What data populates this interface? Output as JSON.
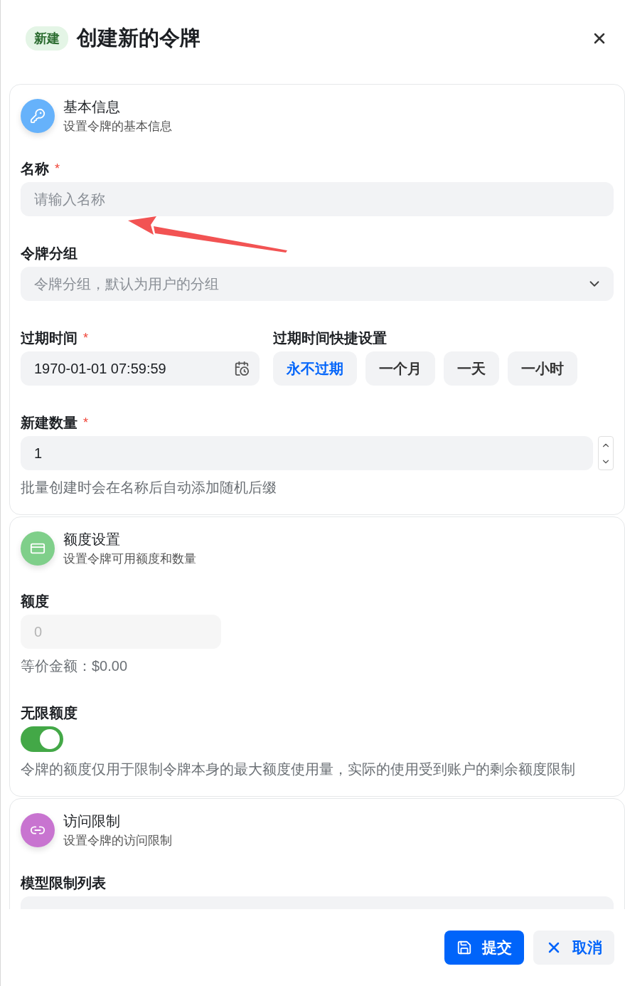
{
  "header": {
    "badge": "新建",
    "title": "创建新的令牌"
  },
  "sections": [
    {
      "kind": "basic",
      "color": "#66b2fb",
      "title": "基本信息",
      "subtitle": "设置令牌的基本信息",
      "fields": [
        {
          "kind": "text",
          "label": "名称",
          "required_mark": "*",
          "placeholder": "请输入名称"
        },
        {
          "kind": "select",
          "label": "令牌分组",
          "placeholder": "令牌分组，默认为用户的分组"
        },
        {
          "kind": "expiry",
          "label": "过期时间",
          "required_mark": "*",
          "value": "1970-01-01 07:59:59",
          "shortcuts_label": "过期时间快捷设置",
          "shortcuts": [
            {
              "label": "永不过期",
              "selected": true
            },
            {
              "label": "一个月",
              "selected": false
            },
            {
              "label": "一天",
              "selected": false
            },
            {
              "label": "一小时",
              "selected": false
            }
          ]
        },
        {
          "kind": "number",
          "label": "新建数量",
          "required_mark": "*",
          "value": "1",
          "help": "批量创建时会在名称后自动添加随机后缀"
        }
      ]
    },
    {
      "kind": "quota",
      "color": "#7fcf8a",
      "title": "额度设置",
      "subtitle": "设置令牌可用额度和数量",
      "fields": [
        {
          "kind": "amount",
          "label": "额度",
          "placeholder": "0",
          "disabled": true,
          "help": "等价金额：$0.00"
        },
        {
          "kind": "toggle",
          "label": "无限额度",
          "on": true,
          "help": "令牌的额度仅用于限制令牌本身的最大额度使用量，实际的使用受到账户的剩余额度限制"
        }
      ]
    },
    {
      "kind": "access",
      "color": "#c874d0",
      "title": "访问限制",
      "subtitle": "设置令牌的访问限制",
      "fields": [
        {
          "kind": "multiselect",
          "label": "模型限制列表"
        }
      ]
    }
  ],
  "footer": {
    "buttons": [
      {
        "kind": "primary",
        "label": "提交"
      },
      {
        "kind": "secondary",
        "label": "取消"
      }
    ]
  }
}
